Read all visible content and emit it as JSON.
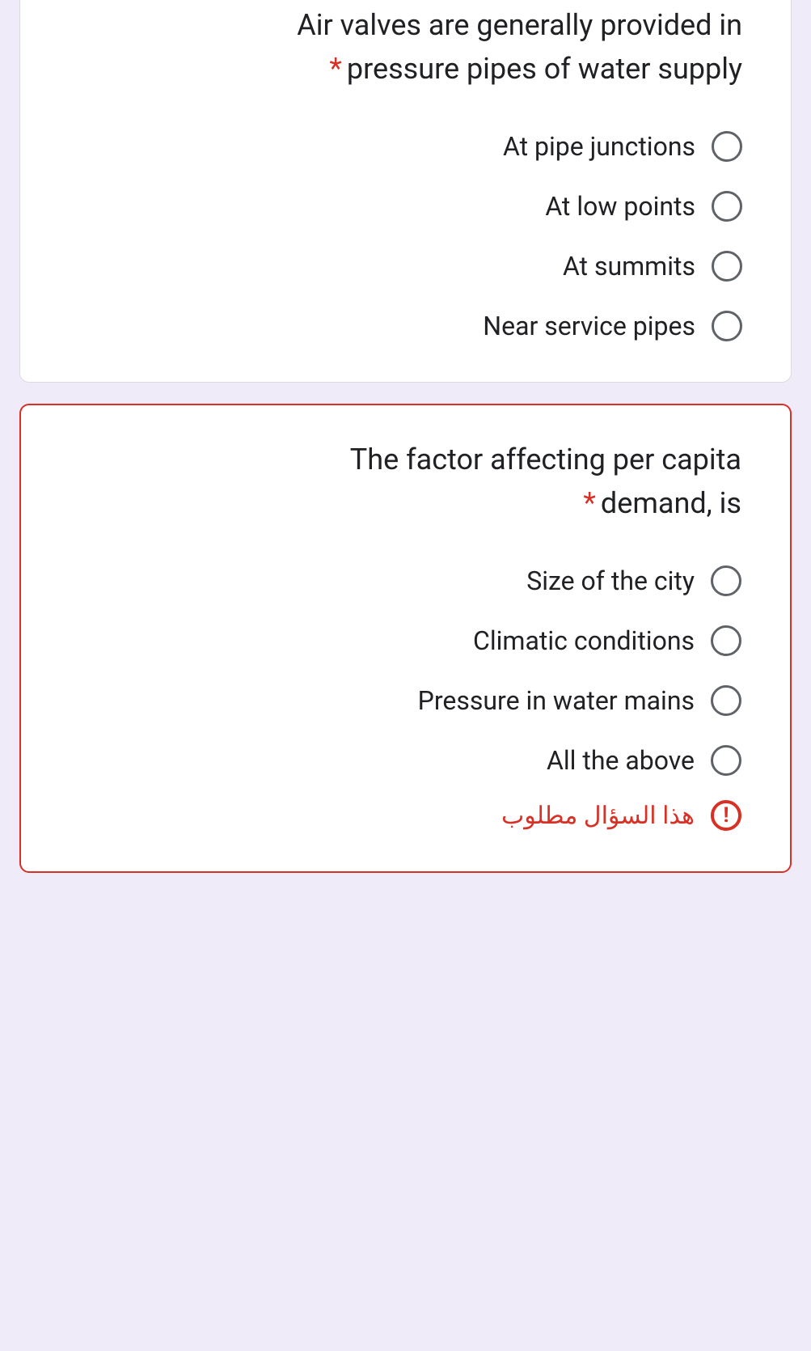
{
  "questions": [
    {
      "title": "Air valves are generally provided in pressure pipes of water supply",
      "required": true,
      "options": [
        "At pipe junctions",
        "At low points",
        "At summits",
        "Near service pipes"
      ]
    },
    {
      "title": "The factor affecting per capita demand, is",
      "required": true,
      "options": [
        "Size of the city",
        "Climatic conditions",
        "Pressure in water mains",
        "All the above"
      ],
      "error_message": "هذا السؤال مطلوب"
    }
  ]
}
